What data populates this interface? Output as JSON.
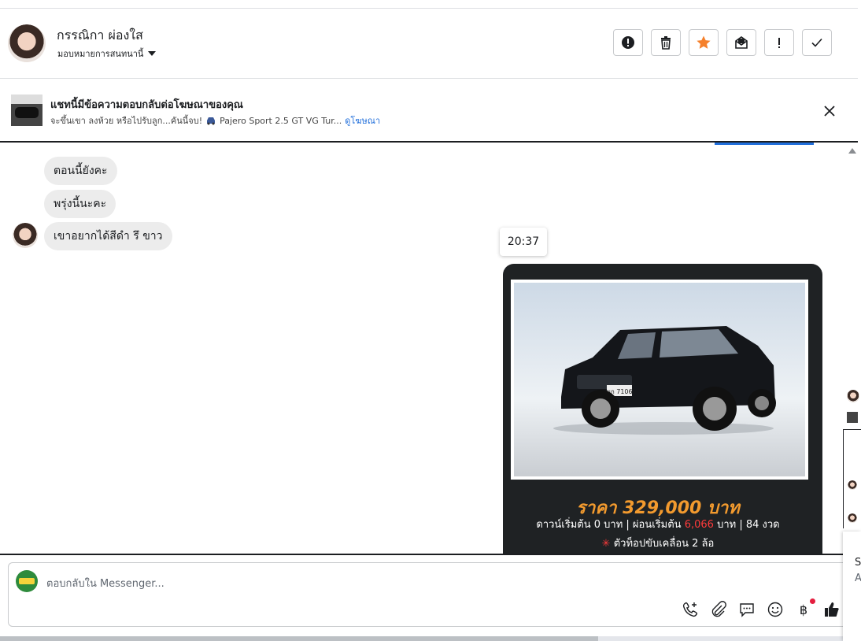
{
  "header": {
    "contact_name": "กรรณิกา ผ่องใส",
    "assign_label": "มอบหมายการสนทนานี้",
    "actions": [
      "spam-icon",
      "trash-icon",
      "star-icon",
      "mark-unread-icon",
      "important-icon",
      "done-icon"
    ],
    "star_color": "#f5802b"
  },
  "ad_banner": {
    "title": "แชทนี้มีข้อความตอบกลับต่อโฆษณาของคุณ",
    "ad_text": "จะขึ้นเขา ลงห้วย หรือไปรับลูก...คันนี้จบ!",
    "car_text": "Pajero Sport 2.5 GT VG Tur...",
    "link": "ดูโฆษณา"
  },
  "messages": [
    {
      "text": "ตอนนี้ยังคะ"
    },
    {
      "text": "พรุ่งนี้นะคะ"
    },
    {
      "text": "เขาอยากได้สีดำ รึ ขาว"
    }
  ],
  "timestamp": "20:37",
  "car_card": {
    "price": "ราคา 329,000 บาท",
    "terms_pre": "ดาวน์เริ่มต้น 0 บาท | ผ่อนเริ่มต้น",
    "installment": "6,066",
    "terms_post": "บาท | 84 งวด",
    "feature_star": "✳",
    "feature": "ตัวท็อปขับเคลื่อน 2 ล้อ",
    "plate": "ขก 7106"
  },
  "composer": {
    "placeholder": "ตอบกลับใน Messenger..."
  },
  "toolbar": [
    "call-icon",
    "attachment-icon",
    "saved-reply-icon",
    "emoji-icon",
    "payment-icon",
    "like-icon"
  ],
  "right_panel": {
    "s": "S",
    "a": "A"
  },
  "colors": {
    "link": "#216fdb",
    "price": "#f29a2e",
    "accent_red": "#ff3b3b"
  }
}
